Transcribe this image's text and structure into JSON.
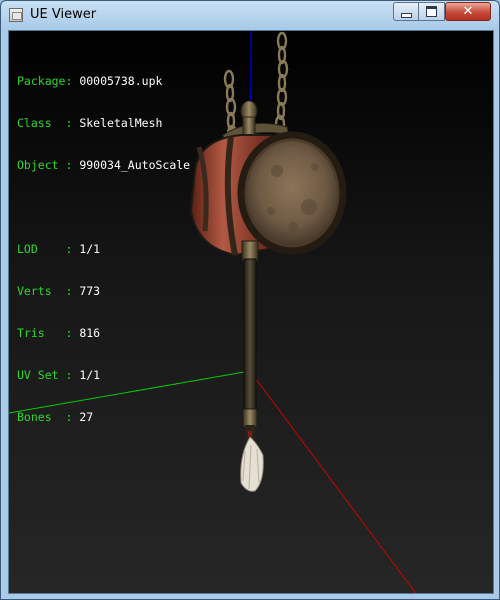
{
  "window": {
    "title": "UE Viewer",
    "controls": {
      "minimize": "minimize",
      "maximize": "maximize",
      "close": "✕"
    }
  },
  "info": {
    "rows": [
      {
        "label": "Package:",
        "value": "00005738.upk"
      },
      {
        "label": "Class  :",
        "value": "SkeletalMesh"
      },
      {
        "label": "Object :",
        "value": "990034_AutoScale"
      }
    ],
    "stats": [
      {
        "label": "LOD    :",
        "value": "1/1"
      },
      {
        "label": "Verts  :",
        "value": "773"
      },
      {
        "label": "Tris   :",
        "value": "816"
      },
      {
        "label": "UV Set :",
        "value": "1/1"
      },
      {
        "label": "Bones  :",
        "value": "27"
      }
    ]
  },
  "colors": {
    "label": "#2fd62f",
    "value": "#ffffff",
    "axis_x": "#cc0000",
    "axis_y": "#00cc00",
    "axis_z": "#0000ff"
  },
  "icons": {
    "app": "app-window-icon",
    "close": "close-icon"
  }
}
